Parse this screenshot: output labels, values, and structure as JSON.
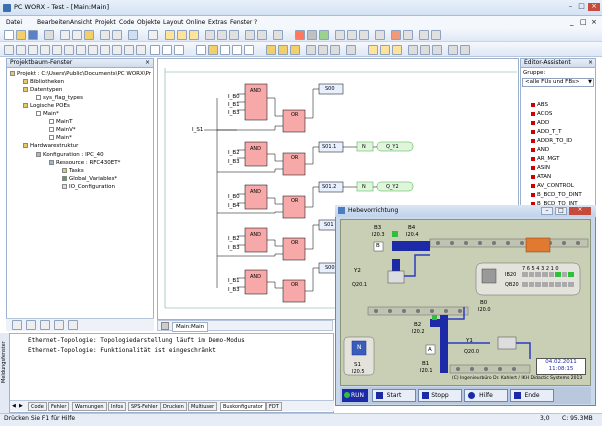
{
  "window": {
    "title": "PC WORX - Test - [Main:Main]"
  },
  "menu": [
    "Datei",
    "Bearbeiten",
    "Ansicht",
    "Projekt",
    "Code",
    "Objekte",
    "Layout",
    "Online",
    "Extras",
    "Fenster",
    "?"
  ],
  "project_tree": {
    "title": "Projektbaum-Fenster",
    "items": [
      "Projekt : C:\\Users\\Public\\Documents\\PC WORX\\Pr",
      "Bibliotheken",
      "Datentypen",
      "sys_flag_types",
      "Logische POEs",
      "Main*",
      "MainT",
      "MainV*",
      "Main*",
      "Hardwarestruktur",
      "Konfiguration : IPC_40",
      "Ressource : RFC430ET*",
      "Tasks",
      "Global_Variables*",
      "IO_Configuration"
    ]
  },
  "diagram": {
    "main_input": "I_S1",
    "and_label": "AND",
    "or_label": "OR",
    "groups": [
      {
        "inputs": [
          "I_B0",
          "I_B1",
          "I_B3"
        ],
        "step": "S00",
        "coil_n": "",
        "coil_q": ""
      },
      {
        "inputs": [
          "I_B2",
          "I_B3"
        ],
        "step": "S01.1",
        "coil_n": "N",
        "coil_q": "Q_Y1"
      },
      {
        "inputs": [
          "I_B0",
          "I_B4"
        ],
        "step": "S01.2",
        "coil_n": "N",
        "coil_q": "Q_Y2"
      },
      {
        "inputs": [
          "I_B2",
          "I_B3"
        ],
        "step": "S01",
        "coil_n": "",
        "coil_q": ""
      },
      {
        "inputs": [
          "I_B1",
          "I_B3"
        ],
        "step": "S00",
        "coil_n": "",
        "coil_q": ""
      }
    ],
    "tab": "Main:Main"
  },
  "editor_assistant": {
    "title": "Editor-Assistent",
    "group_label": "Gruppe:",
    "group_value": "<alle FUs und FBs>",
    "items": [
      "ABS",
      "ACOS",
      "ADD",
      "ADD_T_T",
      "ADDR_TO_ID",
      "AND",
      "AR_MGT",
      "ASIN",
      "ATAN",
      "AV_CONTROL",
      "B_BCD_TO_DINT",
      "B_BCD_TO_INT"
    ]
  },
  "hebe": {
    "title": "Hebevorrichtung",
    "b3": {
      "name": "B3",
      "addr": "I20.3"
    },
    "b4": {
      "name": "B4",
      "addr": "I20.4"
    },
    "y2": {
      "name": "Y2",
      "addr": "Q20.1"
    },
    "b0": {
      "name": "B0",
      "addr": "I20.0"
    },
    "b2": {
      "name": "B2",
      "addr": "I20.2"
    },
    "b1": {
      "name": "B1",
      "addr": "I20.1"
    },
    "y1": {
      "name": "Y1",
      "addr": "Q20.0"
    },
    "s1": {
      "name": "S1",
      "addr": "I20.5"
    },
    "ib20": "IB20",
    "qb20": "QB20",
    "bits_header": "7 6 5 4 3 2 1 0",
    "date": "04.02.2011",
    "time": "11:08:15",
    "copyright": "(C) Ingenieurbüro Dr. Kahlert / IKH Didactic Systems 2013",
    "run": "RUN",
    "buttons": [
      "Start",
      "Stopp",
      "Hilfe",
      "Ende"
    ],
    "letters": {
      "b": "B",
      "a": "A",
      "n": "N"
    }
  },
  "messages": {
    "lines": [
      "Ethernet-Topologie: Topologiedarstellung läuft im Demo-Modus",
      "Ethernet-Topologie: Funktionalität ist eingeschränkt"
    ],
    "side_label": "Meldungsfenster",
    "tabs": [
      "Code",
      "Fehler",
      "Warnungen",
      "Infos",
      "SPS-Fehler",
      "Drucken",
      "Multiuser",
      "Buskonfigurator",
      "FDT"
    ]
  },
  "status": {
    "help": "Drücken Sie F1 für Hilfe",
    "pos": "3,0",
    "mem": "C: 95.3MB"
  }
}
